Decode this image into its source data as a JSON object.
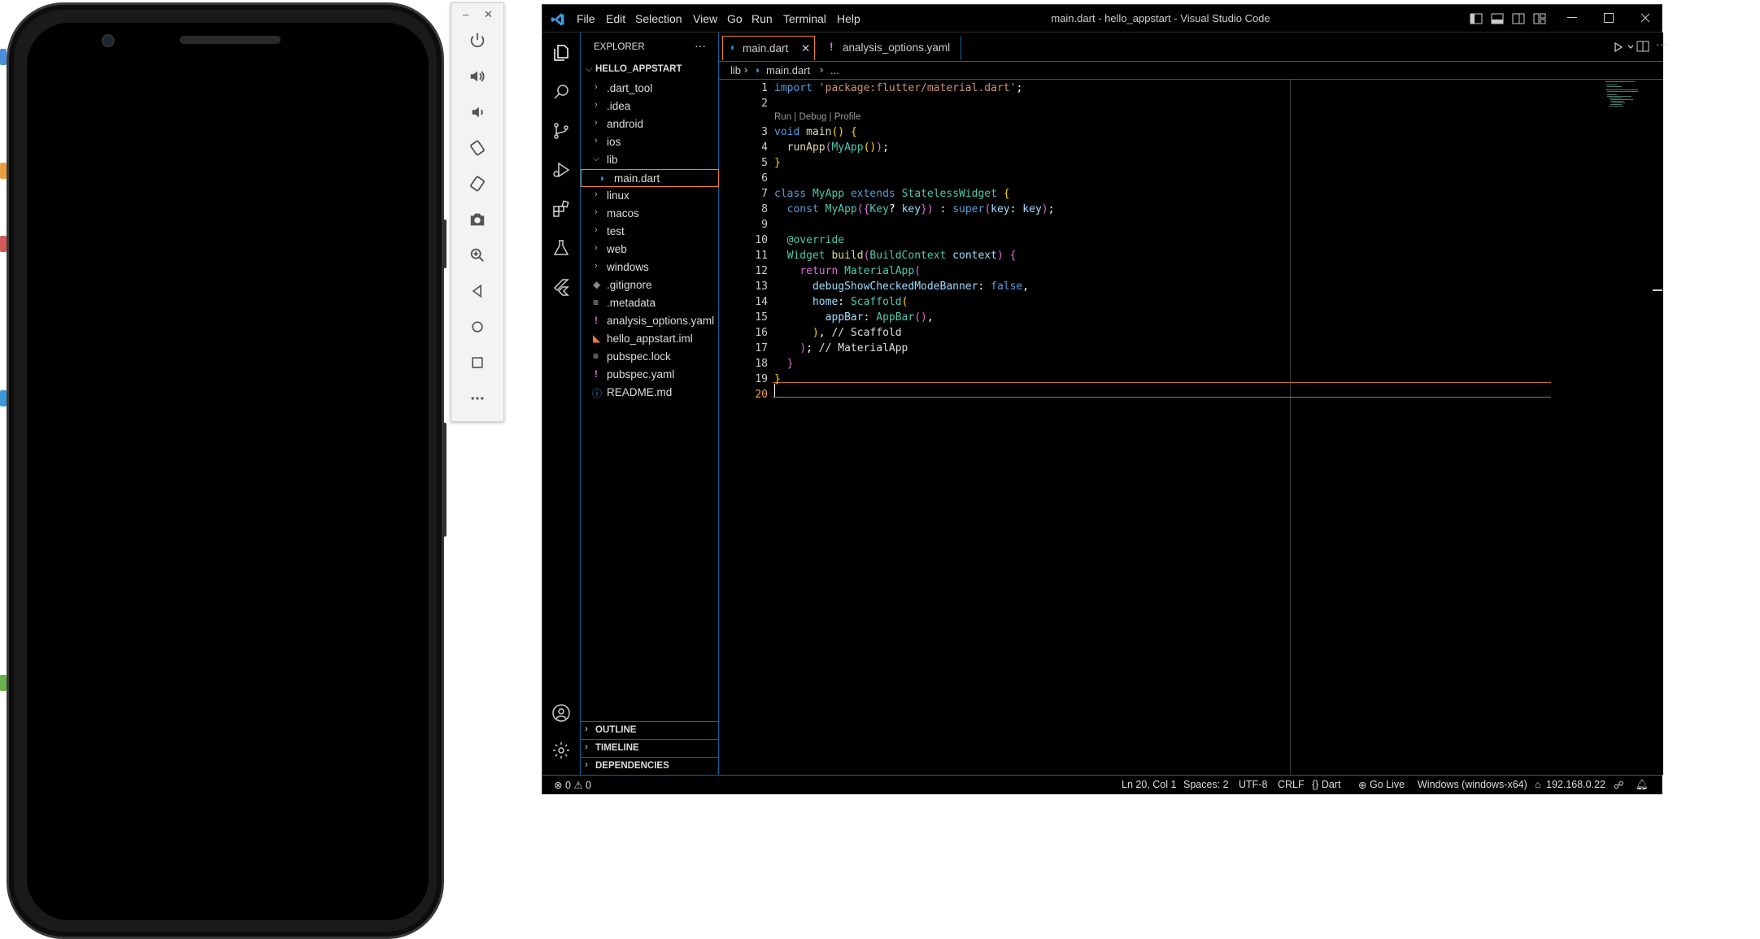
{
  "emulator": {
    "toolbar": {
      "minimize": "–",
      "close": "✕",
      "buttons": [
        "power-icon",
        "volume-up-icon",
        "volume-down-icon",
        "rotate-left-icon",
        "rotate-right-icon",
        "camera-icon",
        "zoom-icon",
        "back-icon",
        "home-icon",
        "overview-icon",
        "more-icon"
      ]
    }
  },
  "vscode": {
    "menu": [
      "File",
      "Edit",
      "Selection",
      "View",
      "Go",
      "Run",
      "Terminal",
      "Help"
    ],
    "title": "main.dart - hello_appstart - Visual Studio Code",
    "explorer": {
      "header": "EXPLORER",
      "more": "···",
      "root": "HELLO_APPSTART",
      "items": [
        {
          "label": ".dart_tool",
          "type": "folder"
        },
        {
          "label": ".idea",
          "type": "folder"
        },
        {
          "label": "android",
          "type": "folder"
        },
        {
          "label": "ios",
          "type": "folder"
        },
        {
          "label": "lib",
          "type": "folder-open"
        },
        {
          "label": "main.dart",
          "type": "dart"
        },
        {
          "label": "linux",
          "type": "folder"
        },
        {
          "label": "macos",
          "type": "folder"
        },
        {
          "label": "test",
          "type": "folder"
        },
        {
          "label": "web",
          "type": "folder"
        },
        {
          "label": "windows",
          "type": "folder"
        },
        {
          "label": ".gitignore",
          "type": "git"
        },
        {
          "label": ".metadata",
          "type": "lines"
        },
        {
          "label": "analysis_options.yaml",
          "type": "yaml"
        },
        {
          "label": "hello_appstart.iml",
          "type": "rss"
        },
        {
          "label": "pubspec.lock",
          "type": "lines"
        },
        {
          "label": "pubspec.yaml",
          "type": "yaml"
        },
        {
          "label": "README.md",
          "type": "info"
        }
      ],
      "sections": [
        "OUTLINE",
        "TIMELINE",
        "DEPENDENCIES"
      ]
    },
    "tabs": [
      {
        "label": "main.dart",
        "close": "✕"
      },
      {
        "label": "analysis_options.yaml",
        "icon": "!"
      }
    ],
    "breadcrumb": {
      "part1": "lib",
      "part2": "main.dart",
      "part3": "..."
    },
    "codelens": "Run | Debug | Profile",
    "line_numbers": [
      "1",
      "2",
      "3",
      "4",
      "5",
      "6",
      "7",
      "8",
      "9",
      "10",
      "11",
      "12",
      "13",
      "14",
      "15",
      "16",
      "17",
      "18",
      "19",
      "20"
    ],
    "status": {
      "problems": "⊗ 0 ⚠ 0",
      "position": "Ln 20, Col 1",
      "spaces": "Spaces: 2",
      "encoding": "UTF-8",
      "eol": "CRLF",
      "language": "{} Dart",
      "golive": "Go Live",
      "device": "Windows (windows-x64)",
      "ip": "192.168.0.22"
    }
  }
}
